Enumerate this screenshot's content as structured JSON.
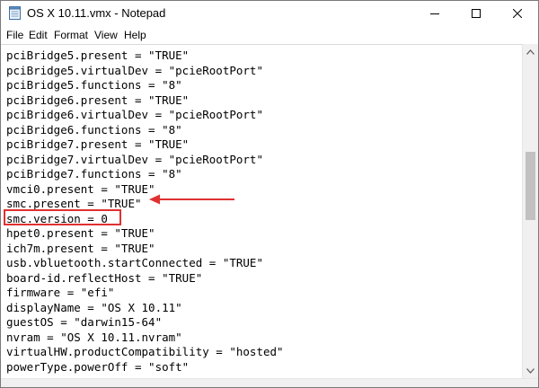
{
  "window": {
    "title": "OS X 10.11.vmx - Notepad"
  },
  "menu": {
    "file": "File",
    "edit": "Edit",
    "format": "Format",
    "view": "View",
    "help": "Help"
  },
  "editor": {
    "lines": [
      "pciBridge5.present = \"TRUE\"",
      "pciBridge5.virtualDev = \"pcieRootPort\"",
      "pciBridge5.functions = \"8\"",
      "pciBridge6.present = \"TRUE\"",
      "pciBridge6.virtualDev = \"pcieRootPort\"",
      "pciBridge6.functions = \"8\"",
      "pciBridge7.present = \"TRUE\"",
      "pciBridge7.virtualDev = \"pcieRootPort\"",
      "pciBridge7.functions = \"8\"",
      "vmci0.present = \"TRUE\"",
      "smc.present = \"TRUE\"",
      "smc.version = 0",
      "hpet0.present = \"TRUE\"",
      "ich7m.present = \"TRUE\"",
      "usb.vbluetooth.startConnected = \"TRUE\"",
      "board-id.reflectHost = \"TRUE\"",
      "firmware = \"efi\"",
      "displayName = \"OS X 10.11\"",
      "guestOS = \"darwin15-64\"",
      "nvram = \"OS X 10.11.nvram\"",
      "virtualHW.productCompatibility = \"hosted\"",
      "powerType.powerOff = \"soft\""
    ]
  },
  "annotation": {
    "color": "#e03131"
  },
  "icons": {
    "app": "notepad-icon",
    "minimize": "minimize-icon",
    "maximize": "maximize-icon",
    "close": "close-icon",
    "scroll_up": "chevron-up-icon",
    "scroll_down": "chevron-down-icon",
    "arrow": "arrow-left-icon"
  }
}
